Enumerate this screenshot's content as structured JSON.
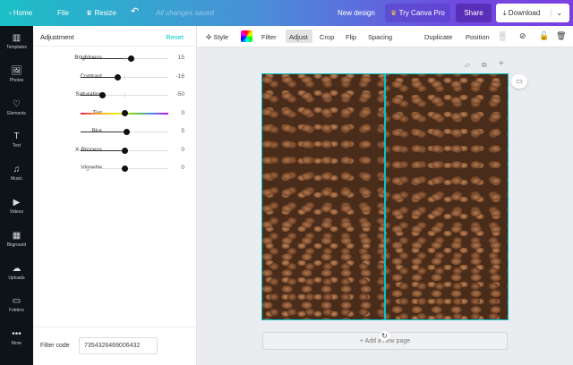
{
  "topbar": {
    "home": "Home",
    "file": "File",
    "resize": "Resize",
    "status": "All changes saved",
    "new_design": "New design",
    "try_pro": "Try Canva Pro",
    "share": "Share",
    "download": "Download"
  },
  "rail": [
    {
      "label": "Templates",
      "icon": "▥"
    },
    {
      "label": "Photos",
      "icon": "🖼"
    },
    {
      "label": "Elements",
      "icon": "♡"
    },
    {
      "label": "Text",
      "icon": "T"
    },
    {
      "label": "Music",
      "icon": "♫"
    },
    {
      "label": "Videos",
      "icon": "▶"
    },
    {
      "label": "Bkground",
      "icon": "▦"
    },
    {
      "label": "Uploads",
      "icon": "☁"
    },
    {
      "label": "Folders",
      "icon": "▭"
    },
    {
      "label": "More",
      "icon": "•••"
    }
  ],
  "panel": {
    "title": "Adjustment",
    "reset": "Reset",
    "sliders": [
      {
        "label": "Brightness",
        "value": "15",
        "level": 15
      },
      {
        "label": "Contrast",
        "value": "-16",
        "level": -16
      },
      {
        "label": "Saturation",
        "value": "-50",
        "level": -50
      },
      {
        "label": "Tint",
        "value": "0",
        "level": 0
      },
      {
        "label": "Blur",
        "value": "5",
        "level": 5
      },
      {
        "label": "X-Process",
        "value": "0",
        "level": 0
      },
      {
        "label": "Vignette",
        "value": "0",
        "level": 0
      }
    ],
    "filter_code_label": "Filter code",
    "filter_code": "7354326469006432"
  },
  "toolbar": {
    "style": "Style",
    "filter": "Filter",
    "adjust": "Adjust",
    "crop": "Crop",
    "flip": "Flip",
    "spacing": "Spacing",
    "duplicate": "Duplicate",
    "position": "Position"
  },
  "canvas": {
    "add_page": "+ Add a new page"
  },
  "colors": {
    "accent": "#00c4cc",
    "rail": "#0e1318"
  }
}
